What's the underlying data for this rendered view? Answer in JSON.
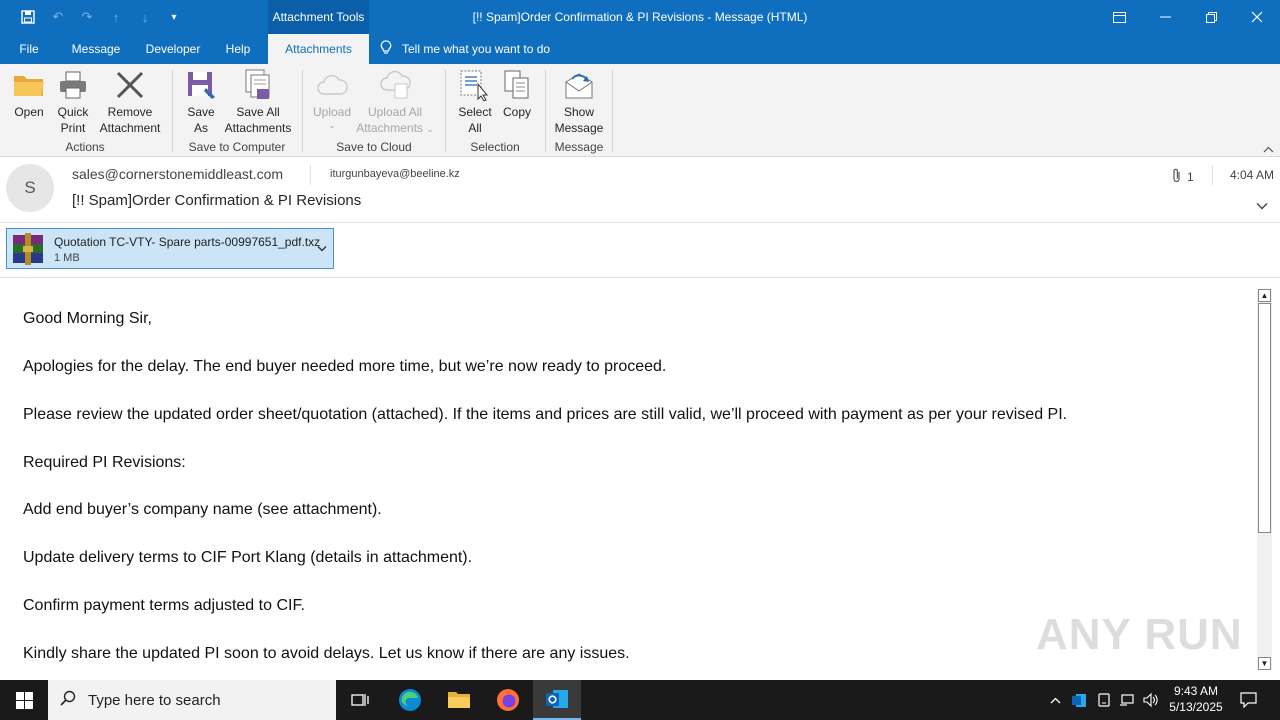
{
  "titlebar": {
    "context_tab": "Attachment Tools",
    "window_title": "[!! Spam]Order Confirmation & PI Revisions  -  Message (HTML)"
  },
  "tabs": [
    "File",
    "Message",
    "Developer",
    "Help",
    "Attachments"
  ],
  "active_tab": "Attachments",
  "tell_me": "Tell me what you want to do",
  "ribbon": {
    "open": "Open",
    "quick_print_1": "Quick",
    "quick_print_2": "Print",
    "remove_1": "Remove",
    "remove_2": "Attachment",
    "group_actions": "Actions",
    "save_as_1": "Save",
    "save_as_2": "As",
    "save_all_1": "Save All",
    "save_all_2": "Attachments",
    "group_save_computer": "Save to Computer",
    "upload": "Upload",
    "upload_all_1": "Upload All",
    "upload_all_2": "Attachments",
    "group_save_cloud": "Save to Cloud",
    "select_all_1": "Select",
    "select_all_2": "All",
    "copy": "Copy",
    "group_selection": "Selection",
    "show_message_1": "Show",
    "show_message_2": "Message",
    "group_message": "Message"
  },
  "header": {
    "avatar_initial": "S",
    "from": "sales@cornerstonemiddleast.com",
    "to": "iturgunbayeva@beeline.kz",
    "subject": "[!! Spam]Order Confirmation & PI Revisions",
    "attachment_count": "1",
    "time": "4:04 AM"
  },
  "attachment": {
    "name": "Quotation TC-VTY- Spare parts-00997651_pdf.txz",
    "size": "1 MB"
  },
  "body": [
    "Good Morning Sir,",
    "Apologies for the delay. The end buyer needed more time, but we’re now ready to proceed.",
    "Please review the updated order sheet/quotation (attached). If the items and prices are still valid, we’ll proceed with payment as per your revised PI.",
    "Required PI Revisions:",
    "Add end buyer’s company name (see attachment).",
    "Update delivery terms to CIF Port Klang (details in attachment).",
    "Confirm payment terms adjusted to CIF.",
    "Kindly share the updated PI soon to avoid delays. Let us know if there are any issues."
  ],
  "watermark": "ANY RUN",
  "taskbar": {
    "search_placeholder": "Type here to search",
    "time": "9:43 AM",
    "date": "5/13/2025"
  },
  "colors": {
    "title_blue": "#106ebe",
    "ribbon_bg": "#f3f3f3",
    "attachment_selected": "#cce4f7",
    "taskbar": "#1a1a1a"
  }
}
